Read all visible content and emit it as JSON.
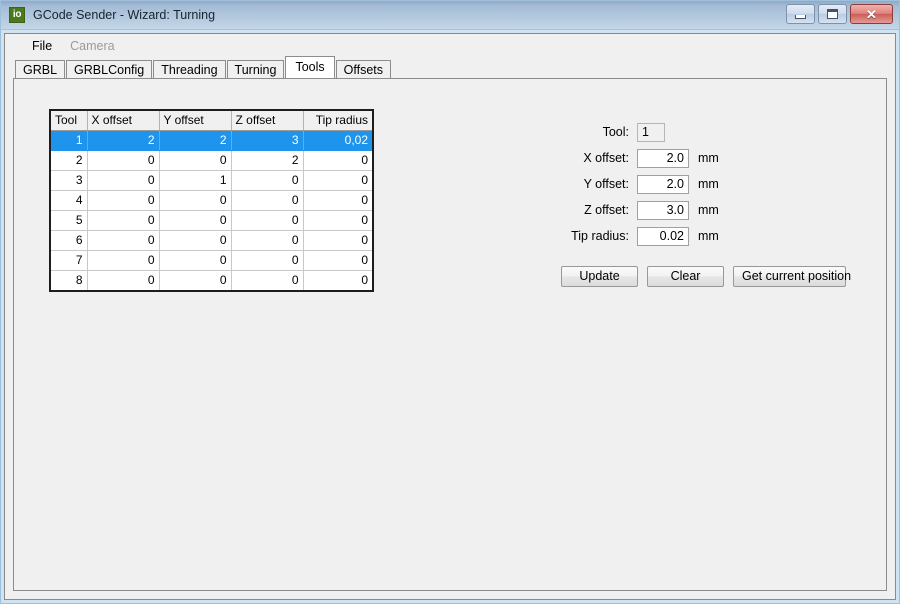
{
  "window": {
    "icon_label": "io",
    "title": "GCode Sender - Wizard: Turning",
    "controls": {
      "minimize": "–",
      "maximize": "□",
      "close": "✕"
    }
  },
  "menubar": {
    "items": [
      {
        "label": "File",
        "disabled": false
      },
      {
        "label": "Camera",
        "disabled": true
      }
    ]
  },
  "tabs": [
    {
      "label": "GRBL",
      "active": false
    },
    {
      "label": "GRBLConfig",
      "active": false
    },
    {
      "label": "Threading",
      "active": false
    },
    {
      "label": "Turning",
      "active": false
    },
    {
      "label": "Tools",
      "active": true
    },
    {
      "label": "Offsets",
      "active": false
    }
  ],
  "tools_table": {
    "headers": [
      "Tool",
      "X offset",
      "Y offset",
      "Z offset",
      "Tip radius"
    ],
    "selected_row_index": 0,
    "rows": [
      {
        "tool": "1",
        "x": "2",
        "y": "2",
        "z": "3",
        "tip": "0,02"
      },
      {
        "tool": "2",
        "x": "0",
        "y": "0",
        "z": "2",
        "tip": "0"
      },
      {
        "tool": "3",
        "x": "0",
        "y": "1",
        "z": "0",
        "tip": "0"
      },
      {
        "tool": "4",
        "x": "0",
        "y": "0",
        "z": "0",
        "tip": "0"
      },
      {
        "tool": "5",
        "x": "0",
        "y": "0",
        "z": "0",
        "tip": "0"
      },
      {
        "tool": "6",
        "x": "0",
        "y": "0",
        "z": "0",
        "tip": "0"
      },
      {
        "tool": "7",
        "x": "0",
        "y": "0",
        "z": "0",
        "tip": "0"
      },
      {
        "tool": "8",
        "x": "0",
        "y": "0",
        "z": "0",
        "tip": "0"
      }
    ]
  },
  "form": {
    "tool": {
      "label": "Tool:",
      "value": "1"
    },
    "x_offset": {
      "label": "X offset:",
      "value": "2.0",
      "unit": "mm"
    },
    "y_offset": {
      "label": "Y offset:",
      "value": "2.0",
      "unit": "mm"
    },
    "z_offset": {
      "label": "Z offset:",
      "value": "3.0",
      "unit": "mm"
    },
    "tip_radius": {
      "label": "Tip radius:",
      "value": "0.02",
      "unit": "mm"
    },
    "buttons": {
      "update": "Update",
      "clear": "Clear",
      "get_current_position": "Get current position"
    }
  },
  "colors": {
    "selection_blue": "#1e94ec",
    "titlebar_top": "#8fa9c8",
    "titlebar_bottom": "#c4d6e7",
    "panel_gray": "#f0f0f0",
    "icon_green": "#4a7a1e"
  }
}
